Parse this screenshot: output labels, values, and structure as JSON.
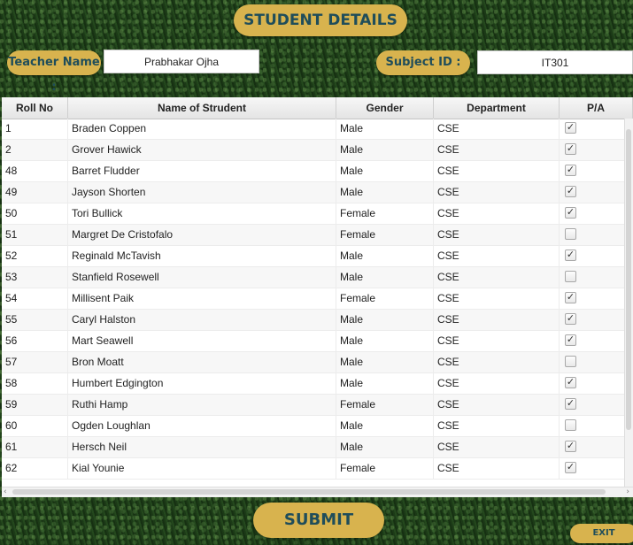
{
  "header": {
    "title": "STUDENT DETAILS"
  },
  "teacher": {
    "label": "Teacher Name :",
    "value": "Prabhakar Ojha"
  },
  "subject": {
    "label": "Subject ID :",
    "value": "IT301"
  },
  "table": {
    "columns": [
      "Roll No",
      "Name of Strudent",
      "Gender",
      "Department",
      "P/A"
    ],
    "rows": [
      {
        "roll": "1",
        "name": "Braden Coppen",
        "gender": "Male",
        "dept": "CSE",
        "present": true
      },
      {
        "roll": "2",
        "name": "Grover Hawick",
        "gender": "Male",
        "dept": "CSE",
        "present": true
      },
      {
        "roll": "48",
        "name": "Barret Fludder",
        "gender": "Male",
        "dept": "CSE",
        "present": true
      },
      {
        "roll": "49",
        "name": "Jayson Shorten",
        "gender": "Male",
        "dept": "CSE",
        "present": true
      },
      {
        "roll": "50",
        "name": "Tori Bullick",
        "gender": "Female",
        "dept": "CSE",
        "present": true
      },
      {
        "roll": "51",
        "name": "Margret De Cristofalo",
        "gender": "Female",
        "dept": "CSE",
        "present": false
      },
      {
        "roll": "52",
        "name": "Reginald McTavish",
        "gender": "Male",
        "dept": "CSE",
        "present": true
      },
      {
        "roll": "53",
        "name": "Stanfield Rosewell",
        "gender": "Male",
        "dept": "CSE",
        "present": false
      },
      {
        "roll": "54",
        "name": "Millisent Paik",
        "gender": "Female",
        "dept": "CSE",
        "present": true
      },
      {
        "roll": "55",
        "name": "Caryl Halston",
        "gender": "Male",
        "dept": "CSE",
        "present": true
      },
      {
        "roll": "56",
        "name": "Mart Seawell",
        "gender": "Male",
        "dept": "CSE",
        "present": true
      },
      {
        "roll": "57",
        "name": "Bron Moatt",
        "gender": "Male",
        "dept": "CSE",
        "present": false
      },
      {
        "roll": "58",
        "name": "Humbert Edgington",
        "gender": "Male",
        "dept": "CSE",
        "present": true
      },
      {
        "roll": "59",
        "name": "Ruthi Hamp",
        "gender": "Female",
        "dept": "CSE",
        "present": true
      },
      {
        "roll": "60",
        "name": "Ogden Loughlan",
        "gender": "Male",
        "dept": "CSE",
        "present": false
      },
      {
        "roll": "61",
        "name": "Hersch Neil",
        "gender": "Male",
        "dept": "CSE",
        "present": true
      },
      {
        "roll": "62",
        "name": "Kial Younie",
        "gender": "Female",
        "dept": "CSE",
        "present": true
      }
    ]
  },
  "actions": {
    "submit_label": "SUBMIT",
    "exit_label": "EXIT"
  },
  "icons": {
    "checkmark": "✓",
    "scroll_left": "‹",
    "scroll_right": "›"
  },
  "colors": {
    "accent": "#d8b34e",
    "accent_text": "#1f4d5a"
  }
}
